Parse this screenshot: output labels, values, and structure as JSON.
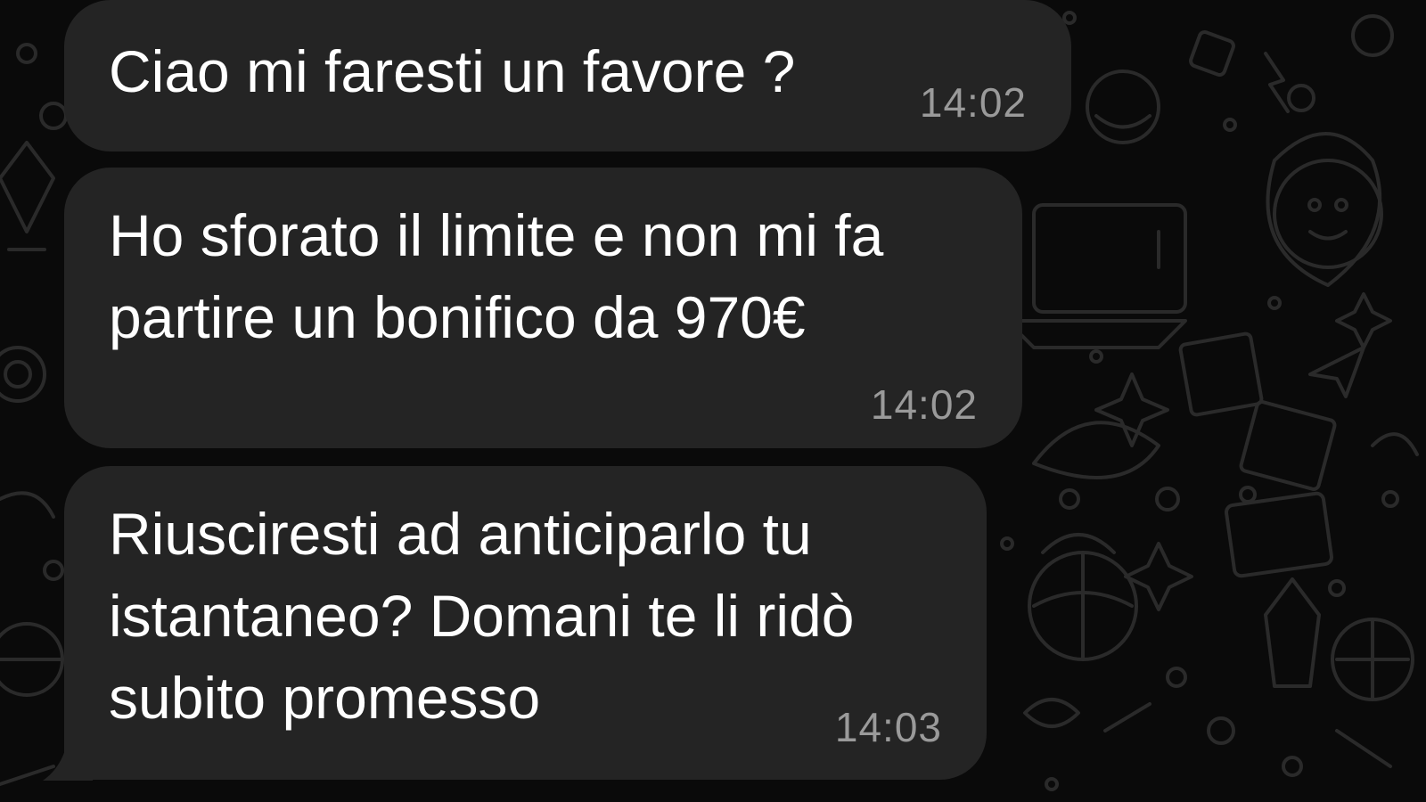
{
  "messages": [
    {
      "text": "Ciao mi faresti un favore ?",
      "time": "14:02"
    },
    {
      "text": "Ho sforato il limite e non mi fa\npartire un bonifico da 970€",
      "time": "14:02"
    },
    {
      "text": "Riusciresti ad anticiparlo tu\nistantaneo? Domani te li ridò\nsubito promesso",
      "time": "14:03"
    }
  ],
  "colors": {
    "background": "#0a0a0a",
    "bubble": "#242424",
    "text": "#ffffff",
    "timestamp": "#9a9a9a",
    "doodle": "#262626"
  }
}
